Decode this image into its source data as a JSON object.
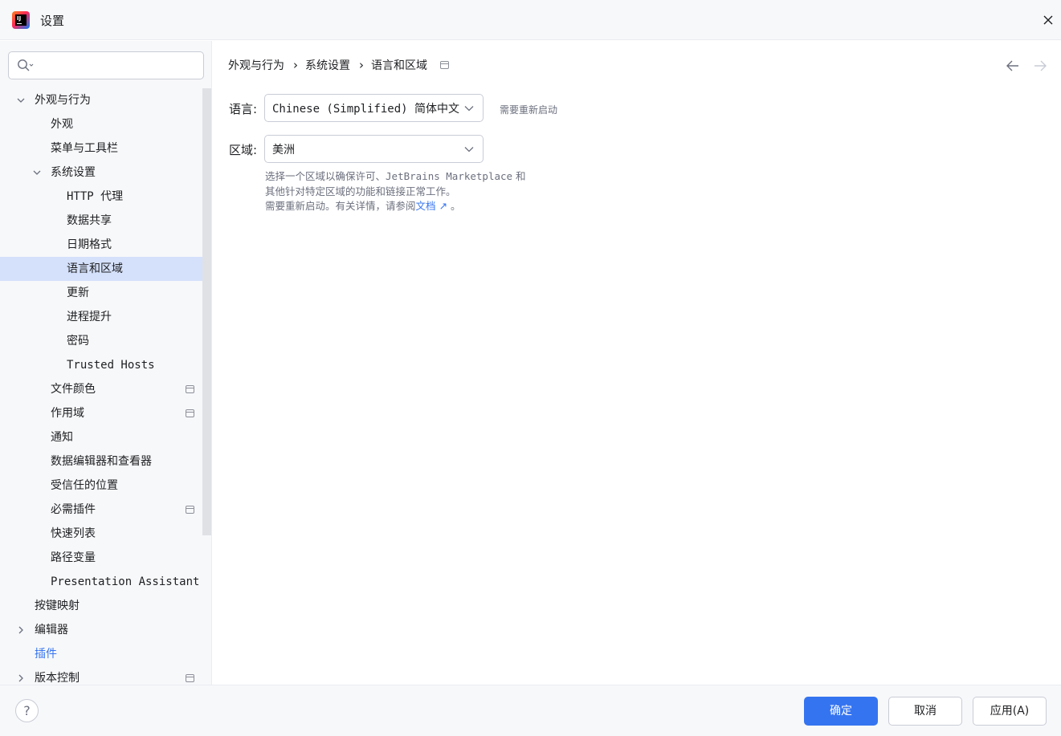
{
  "window": {
    "title": "设置",
    "close_icon": "close-icon"
  },
  "sidebar": {
    "search": {
      "value": "",
      "placeholder": ""
    },
    "items": [
      {
        "label": "外观与行为",
        "level": 0,
        "expander": "expanded",
        "pinned": false,
        "selected": false
      },
      {
        "label": "外观",
        "level": 1,
        "expander": "none",
        "pinned": false,
        "selected": false
      },
      {
        "label": "菜单与工具栏",
        "level": 1,
        "expander": "none",
        "pinned": false,
        "selected": false
      },
      {
        "label": "系统设置",
        "level": 1,
        "expander": "expanded",
        "pinned": false,
        "selected": false
      },
      {
        "label": "HTTP 代理",
        "level": 2,
        "expander": "none",
        "pinned": false,
        "selected": false
      },
      {
        "label": "数据共享",
        "level": 2,
        "expander": "none",
        "pinned": false,
        "selected": false
      },
      {
        "label": "日期格式",
        "level": 2,
        "expander": "none",
        "pinned": false,
        "selected": false
      },
      {
        "label": "语言和区域",
        "level": 2,
        "expander": "none",
        "pinned": false,
        "selected": true
      },
      {
        "label": "更新",
        "level": 2,
        "expander": "none",
        "pinned": false,
        "selected": false
      },
      {
        "label": "进程提升",
        "level": 2,
        "expander": "none",
        "pinned": false,
        "selected": false
      },
      {
        "label": "密码",
        "level": 2,
        "expander": "none",
        "pinned": false,
        "selected": false
      },
      {
        "label": "Trusted Hosts",
        "level": 2,
        "expander": "none",
        "pinned": false,
        "selected": false
      },
      {
        "label": "文件颜色",
        "level": 1,
        "expander": "none",
        "pinned": true,
        "selected": false
      },
      {
        "label": "作用域",
        "level": 1,
        "expander": "none",
        "pinned": true,
        "selected": false
      },
      {
        "label": "通知",
        "level": 1,
        "expander": "none",
        "pinned": false,
        "selected": false
      },
      {
        "label": "数据编辑器和查看器",
        "level": 1,
        "expander": "none",
        "pinned": false,
        "selected": false
      },
      {
        "label": "受信任的位置",
        "level": 1,
        "expander": "none",
        "pinned": false,
        "selected": false
      },
      {
        "label": "必需插件",
        "level": 1,
        "expander": "none",
        "pinned": true,
        "selected": false
      },
      {
        "label": "快速列表",
        "level": 1,
        "expander": "none",
        "pinned": false,
        "selected": false
      },
      {
        "label": "路径变量",
        "level": 1,
        "expander": "none",
        "pinned": false,
        "selected": false
      },
      {
        "label": "Presentation Assistant",
        "level": 1,
        "expander": "none",
        "pinned": false,
        "selected": false
      },
      {
        "label": "按键映射",
        "level": 0,
        "expander": "none",
        "pinned": false,
        "selected": false
      },
      {
        "label": "编辑器",
        "level": 0,
        "expander": "collapsed",
        "pinned": false,
        "selected": false
      },
      {
        "label": "插件",
        "level": 0,
        "expander": "none",
        "pinned": false,
        "selected": false,
        "link": true
      },
      {
        "label": "版本控制",
        "level": 0,
        "expander": "collapsed",
        "pinned": true,
        "selected": false
      }
    ]
  },
  "breadcrumb": {
    "items": [
      "外观与行为",
      "系统设置",
      "语言和区域"
    ],
    "separator": "›"
  },
  "form": {
    "language": {
      "label": "语言:",
      "value": "Chinese (Simplified) 简体中文",
      "hint": "需要重新启动"
    },
    "region": {
      "label": "区域:",
      "value": "美洲",
      "note": {
        "line1_a": "选择一个区域以确保许可、",
        "line1_b": "JetBrains Marketplace",
        "line1_c": " 和",
        "line2": "其他针对特定区域的功能和链接正常工作。",
        "line3_a": "需要重新启动。有关详情，请参阅",
        "line3_link": "文档 ↗",
        "line3_b": " 。"
      }
    }
  },
  "footer": {
    "help_label": "?",
    "ok_label": "确定",
    "cancel_label": "取消",
    "apply_label": "应用(A)"
  },
  "colors": {
    "accent": "#3574f0",
    "selection": "#d5e1fb",
    "sidebar_bg": "#f7f8fa",
    "muted_text": "#6c707e"
  }
}
